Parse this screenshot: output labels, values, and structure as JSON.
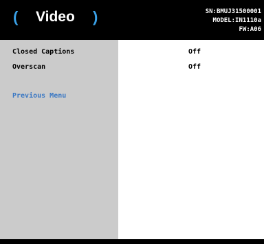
{
  "header": {
    "title": "Video",
    "bracket_left": "(",
    "bracket_right": ")",
    "serial": "SN:BMUJ31500001",
    "model": "MODEL:IN1110a",
    "firmware": "FW:A06"
  },
  "menu": {
    "items": [
      {
        "label": "Closed Captions",
        "value": "Off"
      },
      {
        "label": "Overscan",
        "value": "Off"
      }
    ],
    "previous_label": "Previous Menu"
  },
  "colors": {
    "header_bg": "#000000",
    "accent": "#3aa0e6",
    "sidebar_bg": "#cbcbcb",
    "link": "#3a78c4"
  }
}
